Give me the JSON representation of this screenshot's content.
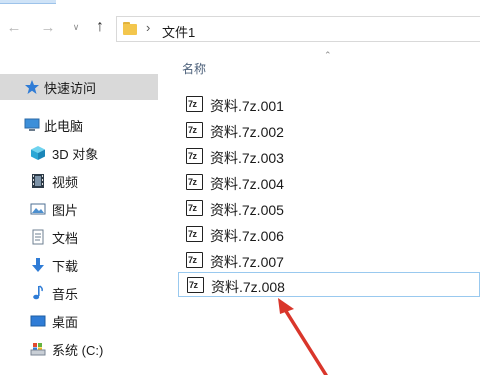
{
  "navigation": {
    "back_icon": "back-arrow-icon",
    "forward_icon": "forward-arrow-icon",
    "recent_icon": "chevron-down-icon",
    "up_icon": "up-arrow-icon"
  },
  "address_bar": {
    "crumbs": [
      "文件1"
    ]
  },
  "sidebar": {
    "items": [
      {
        "label": "快速访问",
        "icon": "star-icon",
        "selected": true
      },
      {
        "label": "此电脑",
        "icon": "computer-icon"
      },
      {
        "label": "3D 对象",
        "icon": "cube-icon"
      },
      {
        "label": "视频",
        "icon": "film-icon"
      },
      {
        "label": "图片",
        "icon": "picture-icon"
      },
      {
        "label": "文档",
        "icon": "document-icon"
      },
      {
        "label": "下载",
        "icon": "download-icon"
      },
      {
        "label": "音乐",
        "icon": "music-icon"
      },
      {
        "label": "桌面",
        "icon": "desktop-icon"
      },
      {
        "label": "系统 (C:)",
        "icon": "drive-icon"
      }
    ]
  },
  "content": {
    "column_header": "名称",
    "files": [
      {
        "name": "资料.7z.001",
        "icon_text": "7z"
      },
      {
        "name": "资料.7z.002",
        "icon_text": "7z"
      },
      {
        "name": "资料.7z.003",
        "icon_text": "7z"
      },
      {
        "name": "资料.7z.004",
        "icon_text": "7z"
      },
      {
        "name": "资料.7z.005",
        "icon_text": "7z"
      },
      {
        "name": "资料.7z.006",
        "icon_text": "7z"
      },
      {
        "name": "资料.7z.007",
        "icon_text": "7z"
      },
      {
        "name": "资料.7z.008",
        "icon_text": "7z",
        "selected": true
      }
    ]
  },
  "colors": {
    "selection_border": "#99c9ef",
    "sidebar_selected": "#d9d9d9",
    "annotation_arrow": "#d9362b"
  }
}
